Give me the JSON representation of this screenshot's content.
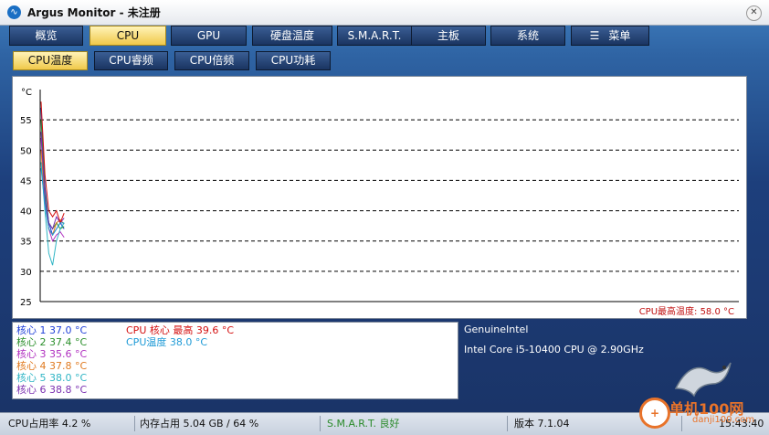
{
  "window": {
    "title": "Argus Monitor - 未注册"
  },
  "tabs": [
    {
      "label": "概览"
    },
    {
      "label": "CPU"
    },
    {
      "label": "GPU"
    },
    {
      "label": "硬盘温度"
    },
    {
      "label": "S.M.A.R.T."
    },
    {
      "label": "主板"
    },
    {
      "label": "系统"
    },
    {
      "label": "菜单"
    }
  ],
  "subtabs": [
    {
      "label": "CPU温度"
    },
    {
      "label": "CPU睿频"
    },
    {
      "label": "CPU倍频"
    },
    {
      "label": "CPU功耗"
    }
  ],
  "chart_data": {
    "type": "line",
    "ylabel": "°C",
    "ylim": [
      25,
      60
    ],
    "yticks": [
      25,
      30,
      35,
      40,
      45,
      50,
      55
    ],
    "annotation": "CPU最高温度: 58.0 °C",
    "series": [
      {
        "name": "核心 1",
        "color": "#1f3fd8",
        "values": [
          57,
          44,
          38,
          36,
          37,
          38,
          37
        ]
      },
      {
        "name": "核心 2",
        "color": "#2b8f2b",
        "values": [
          55,
          43,
          38,
          37,
          38,
          37,
          37.4
        ]
      },
      {
        "name": "核心 3",
        "color": "#b030c0",
        "values": [
          52,
          42,
          37,
          35,
          36,
          36.5,
          35.6
        ]
      },
      {
        "name": "核心 4",
        "color": "#e07a20",
        "values": [
          50,
          41,
          37,
          36,
          38,
          38.5,
          37.8
        ]
      },
      {
        "name": "核心 5",
        "color": "#30b5c5",
        "values": [
          48,
          40,
          33,
          31,
          35,
          37,
          38
        ]
      },
      {
        "name": "核心 6",
        "color": "#7a2fb0",
        "values": [
          53,
          42,
          38,
          37,
          39,
          38,
          38.8
        ]
      },
      {
        "name": "CPU 核心 最高",
        "color": "#d41010",
        "values": [
          58,
          46,
          40,
          39,
          40,
          38,
          39.6
        ]
      },
      {
        "name": "CPU温度",
        "color": "#1e9ad6",
        "values": [
          47,
          41,
          37,
          36,
          37,
          38,
          38
        ]
      }
    ]
  },
  "legend": {
    "cores": [
      {
        "label": "核心 1 37.0 °C",
        "color": "#1f3fd8"
      },
      {
        "label": "核心 2 37.4 °C",
        "color": "#2b8f2b"
      },
      {
        "label": "核心 3 35.6 °C",
        "color": "#b030c0"
      },
      {
        "label": "核心 4 37.8 °C",
        "color": "#e07a20"
      },
      {
        "label": "核心 5 38.0 °C",
        "color": "#30b5c5"
      },
      {
        "label": "核心 6 38.8 °C",
        "color": "#7a2fb0"
      }
    ],
    "extra": [
      {
        "label": "CPU 核心 最高 39.6 °C",
        "color": "#d41010"
      },
      {
        "label": "CPU温度 38.0 °C",
        "color": "#1e9ad6"
      }
    ]
  },
  "cpu_info": {
    "vendor": "GenuineIntel",
    "model": "Intel Core i5-10400 CPU @ 2.90GHz"
  },
  "status": {
    "cpu": "CPU占用率 4.2 %",
    "mem": "内存占用 5.04 GB / 64 %",
    "smart": "S.M.A.R.T. 良好",
    "version": "版本 7.1.04",
    "time": "15:43:40",
    "smart_color": "#2a8a2a"
  },
  "watermark": {
    "site": "单机100网",
    "url": "danji100.com"
  }
}
